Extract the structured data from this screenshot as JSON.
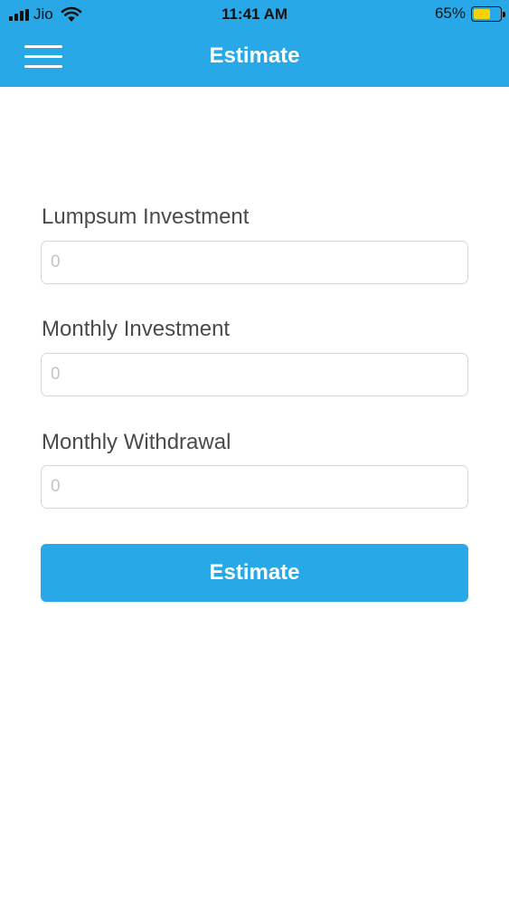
{
  "status_bar": {
    "carrier": "Jio",
    "time": "11:41 AM",
    "battery_percent_label": "65%",
    "battery_level": 0.65,
    "battery_color": "#f5d20c"
  },
  "nav": {
    "menu_icon": "hamburger-menu-icon",
    "title": "Estimate",
    "background_color": "#29a8e8"
  },
  "form": {
    "lumpsum": {
      "label": "Lumpsum Investment",
      "placeholder": "0",
      "value": ""
    },
    "monthly_investment": {
      "label": "Monthly Investment",
      "placeholder": "0",
      "value": ""
    },
    "monthly_withdrawal": {
      "label": "Monthly Withdrawal",
      "placeholder": "0",
      "value": ""
    },
    "submit_label": "Estimate"
  }
}
